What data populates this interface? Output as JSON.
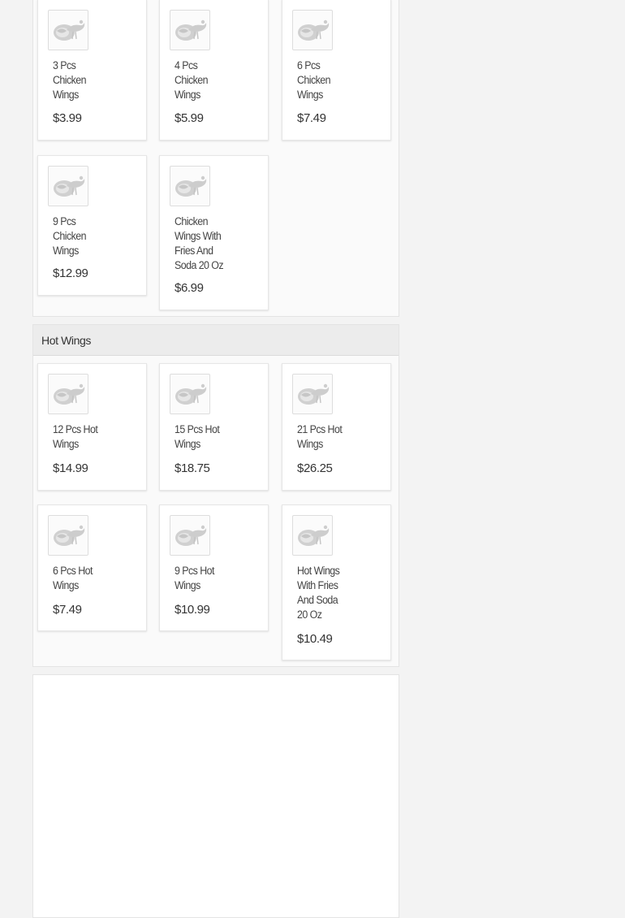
{
  "sections": [
    {
      "title": "",
      "items": [
        {
          "name": "3 Pcs Chicken Wings",
          "price": "$3.99",
          "icon": "chicken-icon"
        },
        {
          "name": "4 Pcs Chicken Wings",
          "price": "$5.99",
          "icon": "chicken-icon"
        },
        {
          "name": "6 Pcs Chicken Wings",
          "price": "$7.49",
          "icon": "chicken-icon"
        },
        {
          "name": "9 Pcs Chicken Wings",
          "price": "$12.99",
          "icon": "chicken-icon"
        },
        {
          "name": "Chicken Wings With Fries And Soda 20 Oz",
          "price": "$6.99",
          "icon": "chicken-icon"
        }
      ]
    },
    {
      "title": "Hot Wings",
      "items": [
        {
          "name": "12 Pcs Hot Wings",
          "price": "$14.99",
          "icon": "chicken-icon"
        },
        {
          "name": "15 Pcs Hot Wings",
          "price": "$18.75",
          "icon": "chicken-icon"
        },
        {
          "name": "21 Pcs Hot Wings",
          "price": "$26.25",
          "icon": "chicken-icon"
        },
        {
          "name": "6 Pcs Hot Wings",
          "price": "$7.49",
          "icon": "chicken-icon"
        },
        {
          "name": "9 Pcs Hot Wings",
          "price": "$10.99",
          "icon": "chicken-icon"
        },
        {
          "name": "Hot Wings With Fries And Soda 20 Oz",
          "price": "$10.49",
          "icon": "chicken-icon"
        }
      ]
    }
  ],
  "colors": {
    "page_background": "#f3f3f3",
    "card_background": "#ffffff",
    "section_header_background": "#ececec",
    "text": "#444444",
    "icon": "#c8c8c8"
  }
}
